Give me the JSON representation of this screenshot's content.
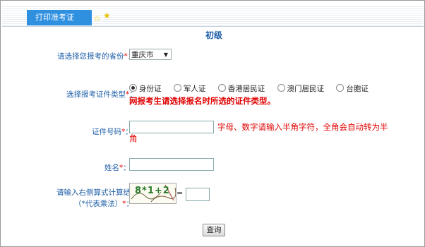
{
  "tab": {
    "label": "打印准考证"
  },
  "level": "初级",
  "province": {
    "label": "请选择您报考的省份",
    "value": "重庆市"
  },
  "id_type": {
    "label": "选择报考证件类型",
    "options": [
      "身份证",
      "军人证",
      "香港居民证",
      "澳门居民证",
      "台胞证"
    ],
    "selected": "身份证",
    "warning": "网报考生请选择报名时所选的证件类型。"
  },
  "id_number": {
    "label": "证件号码",
    "hint_line1": "字母、数字请输入半角字符，全角会自动转为半",
    "hint_line2": "角"
  },
  "name": {
    "label": "姓名"
  },
  "captcha": {
    "label_line1": "请输入右侧算式计算结果",
    "label_line2": "（*代表乘法）",
    "expression": "8*1+2",
    "equals": "="
  },
  "required_mark": "*",
  "colon": "：",
  "query_button": "查询",
  "icons": [
    "star-outline-icon",
    "star-filled-icon",
    "dropdown-arrow-icon"
  ]
}
